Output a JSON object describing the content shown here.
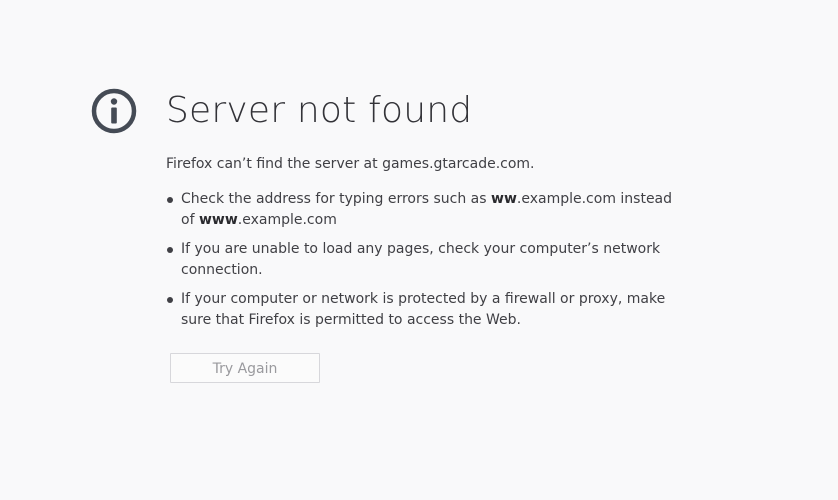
{
  "page": {
    "title": "Server not found",
    "intro": "Firefox can’t find the server at games.gtarcade.com.",
    "tips": [
      {
        "before": "Check the address for typing errors such as ",
        "bold1": "ww",
        "middle": ".example.com instead of ",
        "bold2": "www",
        "after": ".example.com"
      },
      {
        "text": "If you are unable to load any pages, check your computer’s network connection."
      },
      {
        "text": "If your computer or network is protected by a firewall or proxy, make sure that Firefox is permitted to access the Web."
      }
    ],
    "button_label": "Try Again",
    "icon": "info-icon",
    "icon_color": "#454b55"
  }
}
